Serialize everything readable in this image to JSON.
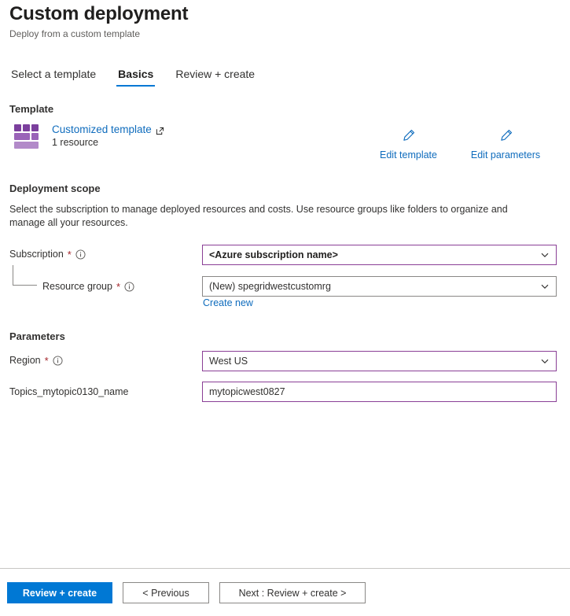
{
  "header": {
    "title": "Custom deployment",
    "subtitle": "Deploy from a custom template"
  },
  "tabs": [
    {
      "label": "Select a template",
      "active": false
    },
    {
      "label": "Basics",
      "active": true
    },
    {
      "label": "Review + create",
      "active": false
    }
  ],
  "template": {
    "heading": "Template",
    "name": "Customized template",
    "resource_count": "1 resource",
    "icon": "template-blocks-icon",
    "external_link_icon": "external-link-icon",
    "edit_template_label": "Edit template",
    "edit_parameters_label": "Edit parameters",
    "edit_icon": "pencil-icon"
  },
  "deployment_scope": {
    "heading": "Deployment scope",
    "description": "Select the subscription to manage deployed resources and costs. Use resource groups like folders to organize and manage all your resources.",
    "subscription": {
      "label": "Subscription",
      "required_marker": "*",
      "info_icon": "info-icon",
      "value": "<Azure subscription name>",
      "chevron_icon": "chevron-down-icon"
    },
    "resource_group": {
      "label": "Resource group",
      "required_marker": "*",
      "info_icon": "info-icon",
      "value": "(New) spegridwestcustomrg",
      "chevron_icon": "chevron-down-icon",
      "create_new_label": "Create new"
    }
  },
  "parameters": {
    "heading": "Parameters",
    "region": {
      "label": "Region",
      "required_marker": "*",
      "info_icon": "info-icon",
      "value": "West US",
      "chevron_icon": "chevron-down-icon"
    },
    "topic_name": {
      "label": "Topics_mytopic0130_name",
      "value": "mytopicwest0827"
    }
  },
  "footer": {
    "review_create_label": "Review + create",
    "previous_label": "< Previous",
    "next_label": "Next : Review + create >"
  },
  "colors": {
    "accent_blue": "#0078d4",
    "link_blue": "#0f6cbd",
    "field_accent_purple": "#8a3f96",
    "required_red": "#a4262c"
  }
}
